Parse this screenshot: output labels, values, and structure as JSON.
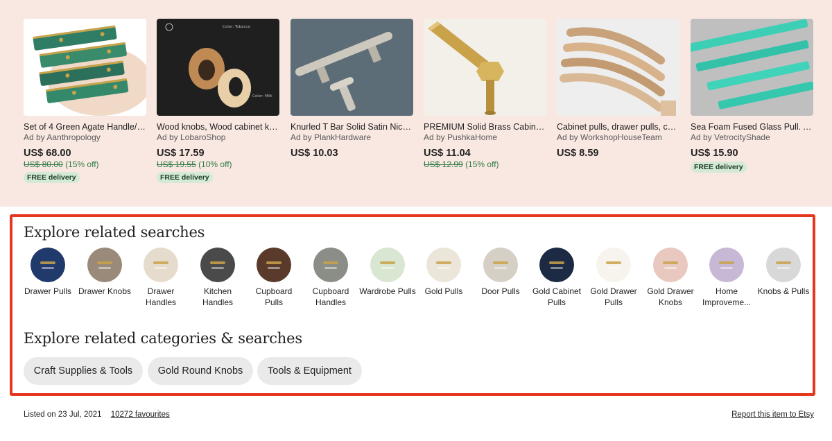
{
  "ads": [
    {
      "title": "Set of 4 Green Agate Handle/P...",
      "by": "Ad by Aanthropology",
      "price": "US$ 68.00",
      "original": "US$ 80.00",
      "discount": "(15% off)",
      "badge": "FREE delivery",
      "image": "green-agate-handles",
      "colors": [
        "#ffffff",
        "#2e7d64",
        "#c9a34a"
      ]
    },
    {
      "title": "Wood knobs, Wood cabinet kno...",
      "by": "Ad by LobaroShop",
      "price": "US$ 17.59",
      "original": "US$ 19.55",
      "discount": "(10% off)",
      "badge": "FREE delivery",
      "image": "wood-ring-knobs",
      "img_text_top": "Color: Tobacco",
      "img_text_bottom": "Color: Milk",
      "colors": [
        "#1f1f1f",
        "#c08a55",
        "#e9cfa8"
      ]
    },
    {
      "title": "Knurled T Bar Solid Satin Nickel...",
      "by": "Ad by PlankHardware",
      "price": "US$ 10.03",
      "original": "",
      "discount": "",
      "badge": "",
      "image": "knurled-t-bar",
      "colors": [
        "#5d6d78",
        "#cdc8bd"
      ]
    },
    {
      "title": "PREMIUM Solid Brass Cabinet H...",
      "by": "Ad by PushkaHome",
      "price": "US$ 11.04",
      "original": "US$ 12.99",
      "discount": "(15% off)",
      "badge": "",
      "image": "brass-hex-handle",
      "colors": [
        "#f3f0ea",
        "#c9a24a"
      ]
    },
    {
      "title": "Cabinet pulls, drawer pulls, cab...",
      "by": "Ad by WorkshopHouseTeam",
      "price": "US$ 8.59",
      "original": "",
      "discount": "",
      "badge": "",
      "image": "wooden-arc-pulls",
      "colors": [
        "#eeeeee",
        "#d7b28a"
      ]
    },
    {
      "title": "Sea Foam Fused Glass Pull. Arti...",
      "by": "Ad by VetrocityShade",
      "price": "US$ 15.90",
      "original": "",
      "discount": "",
      "badge": "FREE delivery",
      "image": "sea-foam-glass-pulls",
      "colors": [
        "#bfbfbf",
        "#3ccfb6"
      ]
    }
  ],
  "related_searches": {
    "heading": "Explore related searches",
    "items": [
      {
        "label": "Drawer Pulls",
        "icon": "drawer-pulls-thumb",
        "color": "#1f3a6b"
      },
      {
        "label": "Drawer Knobs",
        "icon": "drawer-knobs-thumb",
        "color": "#9a8a7a"
      },
      {
        "label": "Drawer Handles",
        "icon": "drawer-handles-thumb",
        "color": "#e6dccd"
      },
      {
        "label": "Kitchen Handles",
        "icon": "kitchen-handles-thumb",
        "color": "#4a4a4a"
      },
      {
        "label": "Cupboard Pulls",
        "icon": "cupboard-pulls-thumb",
        "color": "#5a3a2a"
      },
      {
        "label": "Cupboard Handles",
        "icon": "cupboard-handles-thumb",
        "color": "#8a8e86"
      },
      {
        "label": "Wardrobe Pulls",
        "icon": "wardrobe-pulls-thumb",
        "color": "#d9e6d2"
      },
      {
        "label": "Gold Pulls",
        "icon": "gold-pulls-thumb",
        "color": "#ece6da"
      },
      {
        "label": "Door Pulls",
        "icon": "door-pulls-thumb",
        "color": "#d6cfc6"
      },
      {
        "label": "Gold Cabinet Pulls",
        "icon": "gold-cabinet-pulls-thumb",
        "color": "#1c2a44"
      },
      {
        "label": "Gold Drawer Pulls",
        "icon": "gold-drawer-pulls-thumb",
        "color": "#f7f4ee"
      },
      {
        "label": "Gold Drawer Knobs",
        "icon": "gold-drawer-knobs-thumb",
        "color": "#e9c8bf"
      },
      {
        "label": "Home Improveme...",
        "icon": "home-improvement-thumb",
        "color": "#c7b9d6"
      },
      {
        "label": "Knobs & Pulls",
        "icon": "knobs-pulls-thumb",
        "color": "#d8d8d8"
      }
    ]
  },
  "related_categories": {
    "heading": "Explore related categories & searches",
    "chips": [
      "Craft Supplies & Tools",
      "Gold Round Knobs",
      "Tools & Equipment"
    ]
  },
  "footer": {
    "listed": "Listed on 23 Jul, 2021",
    "favourites": "10272 favourites",
    "report": "Report this item to Etsy"
  },
  "colors": {
    "ads_background": "#f9e8e2",
    "highlight_border": "#e4371e",
    "sale_green": "#2f7a46",
    "badge_background": "#d4e9d7",
    "chip_background": "#eaeaea"
  }
}
